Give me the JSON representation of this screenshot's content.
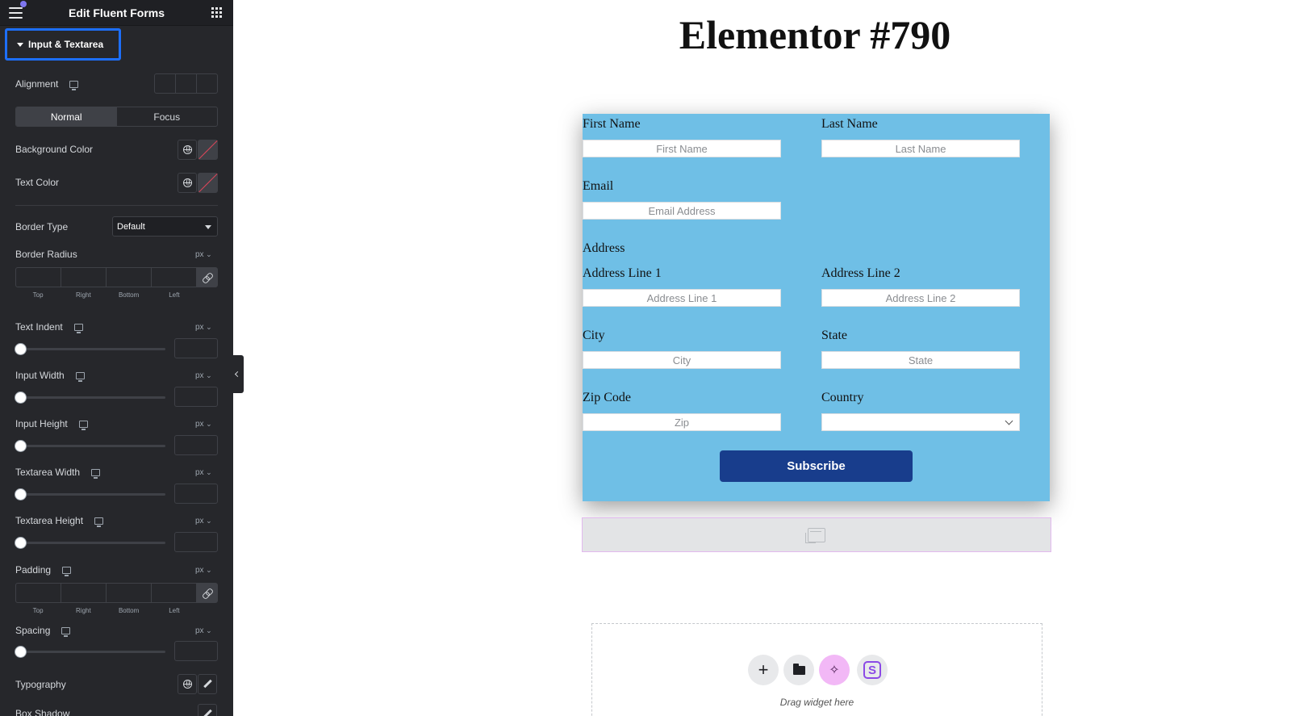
{
  "sidebar": {
    "title": "Edit Fluent Forms",
    "section": "Input & Textarea",
    "alignment_label": "Alignment",
    "tabs": [
      "Normal",
      "Focus"
    ],
    "background_color_label": "Background Color",
    "text_color_label": "Text Color",
    "border_type_label": "Border Type",
    "border_type_value": "Default",
    "border_radius_label": "Border Radius",
    "dim_labels": [
      "Top",
      "Right",
      "Bottom",
      "Left"
    ],
    "unit": "px",
    "text_indent_label": "Text Indent",
    "input_width_label": "Input Width",
    "input_height_label": "Input Height",
    "textarea_width_label": "Textarea Width",
    "textarea_height_label": "Textarea Height",
    "padding_label": "Padding",
    "spacing_label": "Spacing",
    "typography_label": "Typography",
    "box_shadow_label": "Box Shadow"
  },
  "canvas": {
    "page_title": "Elementor #790",
    "form": {
      "first_name_label": "First Name",
      "first_name_placeholder": "First Name",
      "last_name_label": "Last Name",
      "last_name_placeholder": "Last Name",
      "email_label": "Email",
      "email_placeholder": "Email Address",
      "address_label": "Address",
      "address1_label": "Address Line 1",
      "address1_placeholder": "Address Line 1",
      "address2_label": "Address Line 2",
      "address2_placeholder": "Address Line 2",
      "city_label": "City",
      "city_placeholder": "City",
      "state_label": "State",
      "state_placeholder": "State",
      "zip_label": "Zip Code",
      "zip_placeholder": "Zip",
      "country_label": "Country",
      "submit_label": "Subscribe"
    },
    "drop_zone_text": "Drag widget here"
  },
  "colors": {
    "sidebar_bg": "#26272b",
    "form_bg": "#6fbfe6",
    "submit_bg": "#183d8c",
    "highlight": "#1d6ffb"
  }
}
